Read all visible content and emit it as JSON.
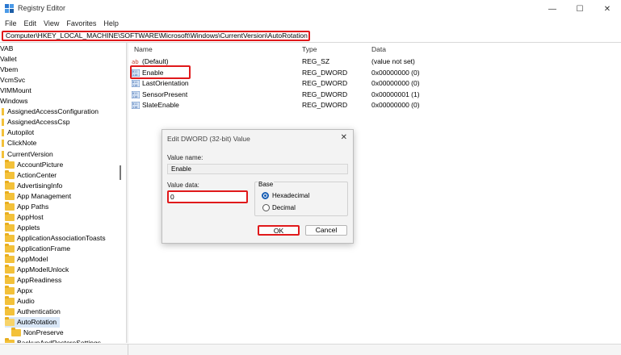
{
  "window": {
    "title": "Registry Editor",
    "controls": {
      "minimize": "—",
      "maximize": "☐",
      "close": "✕"
    }
  },
  "menu": [
    "File",
    "Edit",
    "View",
    "Favorites",
    "Help"
  ],
  "address": "Computer\\HKEY_LOCAL_MACHINE\\SOFTWARE\\Microsoft\\Windows\\CurrentVersion\\AutoRotation",
  "tree": [
    {
      "label": "VAB",
      "kind": "none"
    },
    {
      "label": "Vallet",
      "kind": "none"
    },
    {
      "label": "Vbem",
      "kind": "none"
    },
    {
      "label": "VcmSvc",
      "kind": "none"
    },
    {
      "label": "VIMMount",
      "kind": "none"
    },
    {
      "label": "Windows",
      "kind": "none"
    },
    {
      "label": "AssignedAccessConfiguration",
      "kind": "slim"
    },
    {
      "label": "AssignedAccessCsp",
      "kind": "slim"
    },
    {
      "label": "Autopilot",
      "kind": "slim"
    },
    {
      "label": "ClickNote",
      "kind": "slim"
    },
    {
      "label": "CurrentVersion",
      "kind": "slim"
    },
    {
      "label": "AccountPicture",
      "kind": "folder"
    },
    {
      "label": "ActionCenter",
      "kind": "folder"
    },
    {
      "label": "AdvertisingInfo",
      "kind": "folder"
    },
    {
      "label": "App Management",
      "kind": "folder"
    },
    {
      "label": "App Paths",
      "kind": "folder"
    },
    {
      "label": "AppHost",
      "kind": "folder"
    },
    {
      "label": "Applets",
      "kind": "folder"
    },
    {
      "label": "ApplicationAssociationToasts",
      "kind": "folder"
    },
    {
      "label": "ApplicationFrame",
      "kind": "folder"
    },
    {
      "label": "AppModel",
      "kind": "folder"
    },
    {
      "label": "AppModelUnlock",
      "kind": "folder"
    },
    {
      "label": "AppReadiness",
      "kind": "folder"
    },
    {
      "label": "Appx",
      "kind": "folder"
    },
    {
      "label": "Audio",
      "kind": "folder"
    },
    {
      "label": "Authentication",
      "kind": "folder"
    },
    {
      "label": "AutoRotation",
      "kind": "open",
      "selected": true
    },
    {
      "label": "NonPreserve",
      "kind": "folder",
      "indent": true
    },
    {
      "label": "BackupAndRestoreSettings",
      "kind": "folder"
    }
  ],
  "list": {
    "headers": {
      "name": "Name",
      "type": "Type",
      "data": "Data"
    },
    "rows": [
      {
        "name": "(Default)",
        "type": "REG_SZ",
        "data": "(value not set)",
        "icon": "string"
      },
      {
        "name": "Enable",
        "type": "REG_DWORD",
        "data": "0x00000000 (0)",
        "icon": "binary"
      },
      {
        "name": "LastOrientation",
        "type": "REG_DWORD",
        "data": "0x00000000 (0)",
        "icon": "binary"
      },
      {
        "name": "SensorPresent",
        "type": "REG_DWORD",
        "data": "0x00000001 (1)",
        "icon": "binary"
      },
      {
        "name": "SlateEnable",
        "type": "REG_DWORD",
        "data": "0x00000000 (0)",
        "icon": "binary"
      }
    ]
  },
  "dialog": {
    "title": "Edit DWORD (32-bit) Value",
    "close": "✕",
    "value_name_label": "Value name:",
    "value_name": "Enable",
    "value_data_label": "Value data:",
    "value_data": "0",
    "base_label": "Base",
    "radio_hex": "Hexadecimal",
    "radio_dec": "Decimal",
    "ok": "OK",
    "cancel": "Cancel"
  },
  "colors": {
    "highlight": "#e0191b",
    "folder": "#f3c13a",
    "selection": "#d9e7f7",
    "radio": "#1a5fb4"
  }
}
